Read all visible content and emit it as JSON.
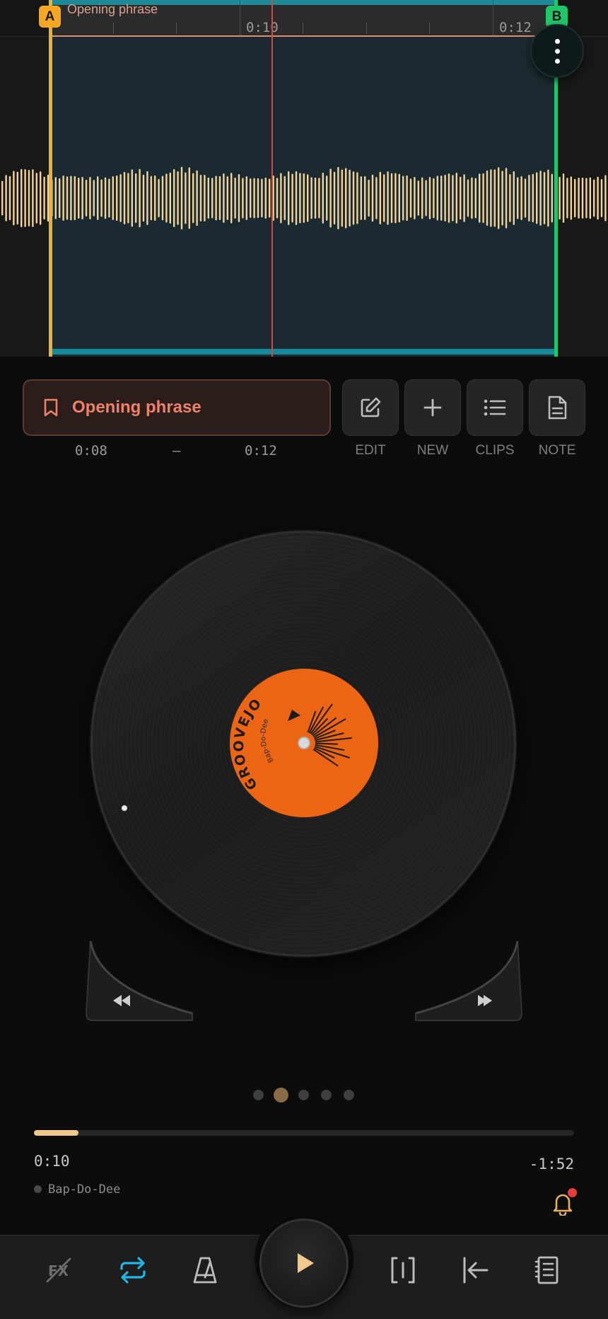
{
  "waveform": {
    "region_label": "Opening phrase",
    "marker_a": "A",
    "marker_b": "B",
    "ruler_times": [
      "0:10",
      "0:12"
    ]
  },
  "clip": {
    "name": "Opening phrase",
    "start": "0:08",
    "separator": "–",
    "end": "0:12"
  },
  "clip_tools": [
    {
      "label": "EDIT",
      "icon": "pencil-square-icon"
    },
    {
      "label": "NEW",
      "icon": "plus-icon"
    },
    {
      "label": "CLIPS",
      "icon": "list-icon"
    },
    {
      "label": "NOTE",
      "icon": "document-icon"
    }
  ],
  "record": {
    "brand": "GROOVEJOG",
    "title": "Bap-Do-Dee",
    "color": "#ec6514"
  },
  "pager": {
    "count": 5,
    "active_index": 1
  },
  "playback": {
    "elapsed": "0:10",
    "remaining": "-1:52",
    "progress": 0.083,
    "track_name": "Bap-Do-Dee"
  },
  "colors": {
    "accent_orange": "#f0826a",
    "loop_teal": "#168a98",
    "marker_a": "#f5a623",
    "marker_b": "#21c66b",
    "waveform": "#f2d49a",
    "playhead": "#d64a42",
    "loop_active": "#22b5e6"
  },
  "toolbar": [
    {
      "name": "fx-toggle",
      "icon": "fx-off-icon"
    },
    {
      "name": "loop-toggle",
      "icon": "repeat-icon",
      "active": true
    },
    {
      "name": "metronome",
      "icon": "metronome-icon"
    },
    {
      "name": "play",
      "icon": "play-icon"
    },
    {
      "name": "marker-select",
      "icon": "bracket-cursor-icon"
    },
    {
      "name": "jump-start",
      "icon": "arrow-to-start-icon"
    },
    {
      "name": "notes",
      "icon": "notebook-icon"
    }
  ]
}
